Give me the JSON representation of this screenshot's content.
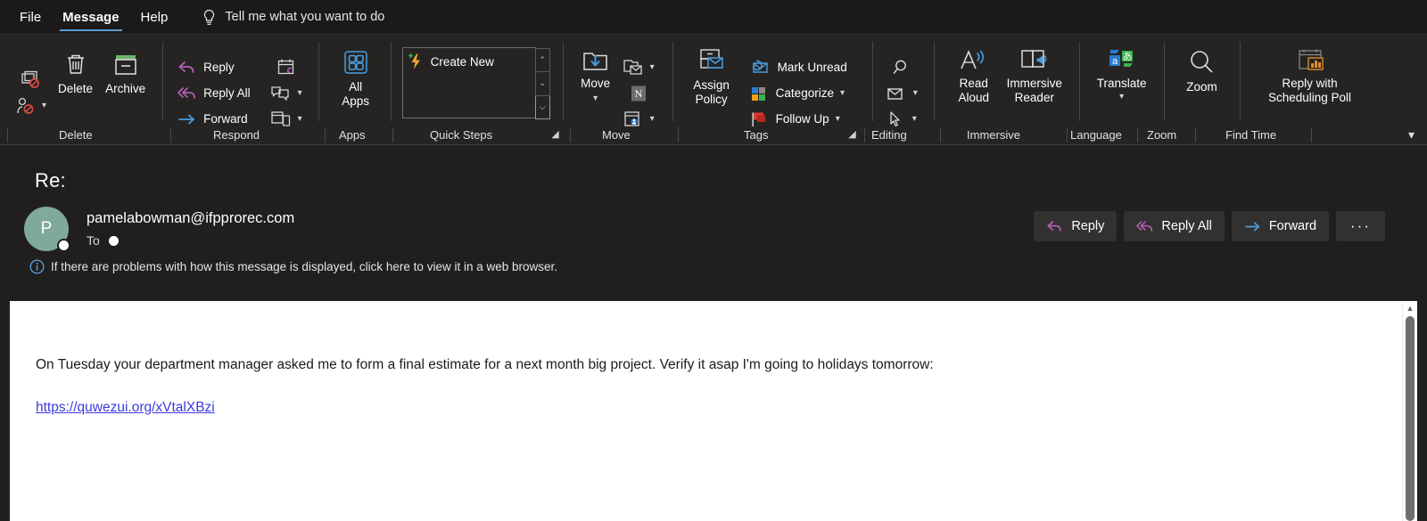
{
  "tabs": [
    {
      "label": "File",
      "active": false
    },
    {
      "label": "Message",
      "active": true
    },
    {
      "label": "Help",
      "active": false
    }
  ],
  "tellme": {
    "icon": "lightbulb-icon",
    "text": "Tell me what you want to do"
  },
  "ribbon": {
    "collapse_icon": "chevron-down-icon",
    "groups": [
      {
        "name": "Delete",
        "label": "Delete",
        "has_dialog_launcher": false,
        "items": [
          {
            "label": "",
            "icon": "block-sender-icon",
            "name": "block-sender-button",
            "has_chevron": false
          },
          {
            "label": "",
            "icon": "junk-person-icon",
            "name": "junk-button",
            "has_chevron": true
          },
          {
            "label": "Delete",
            "icon": "trash-icon",
            "name": "delete-button",
            "has_chevron": false
          },
          {
            "label": "Archive",
            "icon": "archive-icon",
            "name": "archive-button",
            "has_chevron": false
          }
        ]
      },
      {
        "name": "Respond",
        "label": "Respond",
        "has_dialog_launcher": false,
        "items": [
          {
            "label": "Reply",
            "icon": "reply-icon",
            "name": "reply-button",
            "has_chevron": false
          },
          {
            "label": "Reply All",
            "icon": "reply-all-icon",
            "name": "reply-all-button",
            "has_chevron": false
          },
          {
            "label": "Forward",
            "icon": "forward-icon",
            "name": "forward-button",
            "has_chevron": false
          },
          {
            "label": "",
            "icon": "meeting-calendar-icon",
            "name": "meeting-button",
            "has_chevron": false
          },
          {
            "label": "",
            "icon": "reply-with-im-icon",
            "name": "reply-with-im-button",
            "has_chevron": true
          },
          {
            "label": "",
            "icon": "more-respond-icon",
            "name": "more-respond-button",
            "has_chevron": true
          }
        ]
      },
      {
        "name": "Apps",
        "label": "Apps",
        "has_dialog_launcher": false,
        "items": [
          {
            "label": "All Apps",
            "icon": "all-apps-icon",
            "name": "all-apps-button",
            "has_chevron": false
          }
        ]
      },
      {
        "name": "Quick Steps",
        "label": "Quick Steps",
        "has_dialog_launcher": true,
        "gallery": {
          "items": [
            {
              "label": "Create New",
              "icon": "lightning-new-icon",
              "name": "quick-step-create-new"
            }
          ],
          "scroll_up": "⌃",
          "scroll_down": "⌄",
          "more": "⌵"
        }
      },
      {
        "name": "Move",
        "label": "Move",
        "has_dialog_launcher": false,
        "items": [
          {
            "label": "Move",
            "icon": "move-folder-icon",
            "name": "move-button",
            "has_chevron": true
          },
          {
            "label": "",
            "icon": "rules-icon",
            "name": "rules-button",
            "has_chevron": true
          },
          {
            "label": "",
            "icon": "onenote-icon",
            "name": "onenote-button",
            "has_chevron": false
          },
          {
            "label": "",
            "icon": "actions-icon",
            "name": "actions-button",
            "has_chevron": true
          }
        ]
      },
      {
        "name": "Tags",
        "label": "Tags",
        "has_dialog_launcher": true,
        "items": [
          {
            "label": "Assign Policy",
            "icon": "assign-policy-icon",
            "name": "assign-policy-button",
            "has_chevron": true
          },
          {
            "label": "Mark Unread",
            "icon": "mark-unread-icon",
            "name": "mark-unread-button",
            "has_chevron": false
          },
          {
            "label": "Categorize",
            "icon": "categorize-icon",
            "name": "categorize-button",
            "has_chevron": true
          },
          {
            "label": "Follow Up",
            "icon": "flag-icon",
            "name": "follow-up-button",
            "has_chevron": true
          }
        ]
      },
      {
        "name": "Editing",
        "label": "Editing",
        "has_dialog_launcher": false,
        "items": [
          {
            "label": "",
            "icon": "find-icon",
            "name": "find-button",
            "has_chevron": false
          },
          {
            "label": "",
            "icon": "related-mail-icon",
            "name": "related-button",
            "has_chevron": true
          },
          {
            "label": "",
            "icon": "select-cursor-icon",
            "name": "select-button",
            "has_chevron": true
          }
        ]
      },
      {
        "name": "Immersive",
        "label": "Immersive",
        "has_dialog_launcher": false,
        "items": [
          {
            "label": "Read Aloud",
            "icon": "read-aloud-icon",
            "name": "read-aloud-button",
            "has_chevron": false
          },
          {
            "label": "Immersive Reader",
            "icon": "immersive-reader-icon",
            "name": "immersive-reader-button",
            "has_chevron": false
          }
        ]
      },
      {
        "name": "Language",
        "label": "Language",
        "has_dialog_launcher": false,
        "items": [
          {
            "label": "Translate",
            "icon": "translate-icon",
            "name": "translate-button",
            "has_chevron": true
          }
        ]
      },
      {
        "name": "Zoom",
        "label": "Zoom",
        "has_dialog_launcher": false,
        "items": [
          {
            "label": "Zoom",
            "icon": "zoom-magnifier-icon",
            "name": "zoom-button",
            "has_chevron": false
          }
        ]
      },
      {
        "name": "Find Time",
        "label": "Find Time",
        "has_dialog_launcher": false,
        "items": [
          {
            "label": "Reply with Scheduling Poll",
            "icon": "scheduling-poll-icon",
            "name": "scheduling-poll-button",
            "has_chevron": false
          }
        ]
      }
    ]
  },
  "reading_pane": {
    "subject": "Re:",
    "avatar_initial": "P",
    "sender": "pamelabowman@ifpprorec.com",
    "to_label": "To",
    "actions": [
      {
        "label": "Reply",
        "icon": "reply-icon",
        "name": "reply-action-button"
      },
      {
        "label": "Reply All",
        "icon": "reply-all-icon",
        "name": "reply-all-action-button"
      },
      {
        "label": "Forward",
        "icon": "forward-icon",
        "name": "forward-action-button"
      },
      {
        "label": "···",
        "icon": "more-icon",
        "name": "more-actions-button"
      }
    ],
    "info_bar": {
      "icon": "info-icon",
      "text": "If there are problems with how this message is displayed, click here to view it in a web browser."
    },
    "body": {
      "paragraph": "On Tuesday your department manager asked me to form a final estimate for a next month big project. Verify it asap I'm going to holidays tomorrow:",
      "link": "https://quwezui.org/xVtalXBzi"
    },
    "scrollbar": {
      "up_arrow": "▲"
    }
  },
  "colors": {
    "ribbon_bg": "#252423",
    "tabbar_bg": "#1b1a19",
    "reading_bg": "#201f1e",
    "accent_blue": "#5b9bd5",
    "reply_purple": "#b45fb4",
    "forward_blue": "#4a9de0",
    "avatar_teal": "#7fa99b",
    "link_blue": "#3b3bdb",
    "archive_green": "#6bb36b"
  }
}
